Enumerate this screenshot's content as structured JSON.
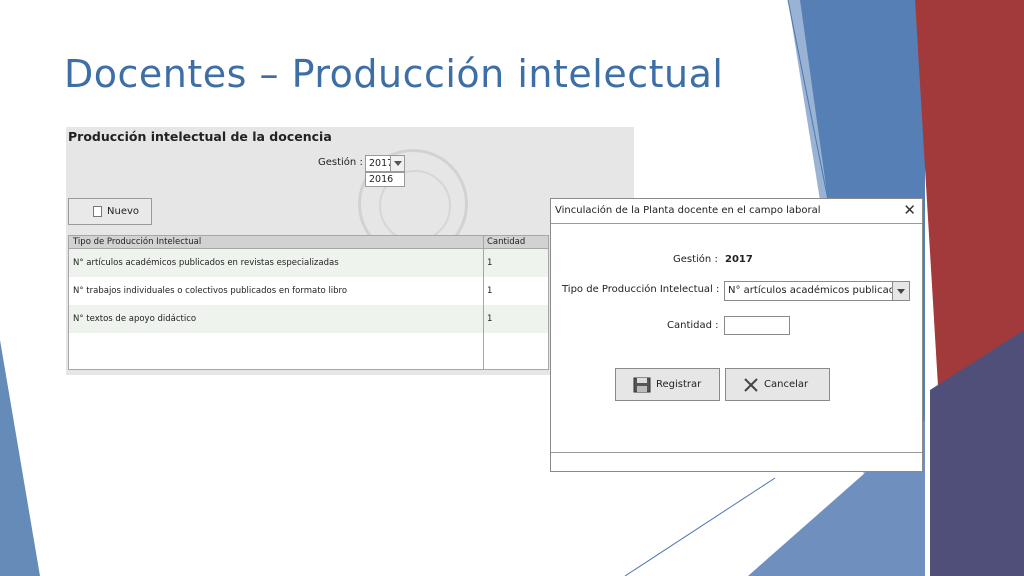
{
  "slide": {
    "title": "Docentes – Producción intelectual"
  },
  "panel": {
    "title": "Producción intelectual de la docencia",
    "gestion_label": "Gestión :",
    "gestion_selected": "2017",
    "gestion_options": [
      "2016"
    ],
    "new_button_label": "Nuevo",
    "table": {
      "columns": [
        "Tipo de Producción Intelectual",
        "Cantidad"
      ],
      "rows": [
        [
          "N° artículos académicos publicados en revistas especializadas",
          "1"
        ],
        [
          "N° trabajos individuales o colectivos publicados en formato libro",
          "1"
        ],
        [
          "N° textos de apoyo didáctico",
          "1"
        ]
      ]
    }
  },
  "dialog": {
    "title": "Vinculación de la Planta docente en el campo laboral",
    "close_icon": "close-icon",
    "gestion_label": "Gestión :",
    "gestion_value": "2017",
    "tipo_label": "Tipo de Producción Intelectual :",
    "tipo_value": "N° artículos académicos publicados",
    "cantidad_label": "Cantidad :",
    "cantidad_value": "",
    "register_label": "Registrar",
    "cancel_label": "Cancelar"
  },
  "colors": {
    "title_blue": "#3d6fa6",
    "deco_blue": "#4a78ad",
    "deco_red": "#a23a3c",
    "panel_bg": "#e6e6e6"
  }
}
